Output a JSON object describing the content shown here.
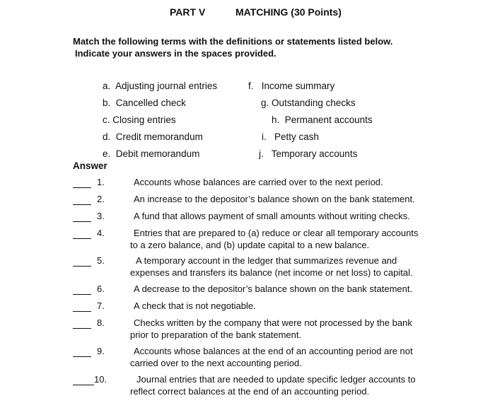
{
  "header": {
    "part": "PART V",
    "title": "MATCHING (30 Points)"
  },
  "instructions": {
    "line1": "Match the following terms with the definitions or statements listed below.",
    "line2": "Indicate your answers in the spaces provided."
  },
  "terms_left": [
    {
      "letter": "a.",
      "term": "Adjusting journal entries"
    },
    {
      "letter": "b.",
      "term": "Cancelled check"
    },
    {
      "letter": "c.",
      "term": "Closing entries"
    },
    {
      "letter": "d.",
      "term": "Credit memorandum"
    },
    {
      "letter": "e.",
      "term": "Debit memorandum"
    }
  ],
  "terms_right": [
    {
      "letter": "f.",
      "term": "Income summary"
    },
    {
      "letter": "g.",
      "term": "Outstanding checks"
    },
    {
      "letter": "h.",
      "term": "Permanent accounts"
    },
    {
      "letter": "i.",
      "term": "Petty cash"
    },
    {
      "letter": "j.",
      "term": "Temporary accounts"
    }
  ],
  "answer_header": "Answer",
  "questions": [
    {
      "number": "1.",
      "line1": "Accounts whose balances are carried over to the next period.",
      "line2": ""
    },
    {
      "number": "2.",
      "line1": "An increase to the depositor’s balance shown on the bank statement.",
      "line2": ""
    },
    {
      "number": "3.",
      "line1": "A fund that allows payment of small amounts without writing checks.",
      "line2": ""
    },
    {
      "number": "4.",
      "line1": "Entries that are prepared to (a) reduce or clear all temporary accounts",
      "line2": "to a zero balance, and (b) update capital to a new balance."
    },
    {
      "number": "5.",
      "line1": "A temporary account in the ledger that summarizes revenue and",
      "line2": "expenses and transfers its balance (net income or net loss) to capital."
    },
    {
      "number": "6.",
      "line1": "A decrease to the depositor’s balance shown on the bank statement.",
      "line2": ""
    },
    {
      "number": "7.",
      "line1": "A check that is not negotiable.",
      "line2": ""
    },
    {
      "number": "8.",
      "line1": "Checks written by the company that were not processed by the bank",
      "line2": "prior to preparation of the bank statement."
    },
    {
      "number": "9.",
      "line1": "Accounts whose balances at the end of an accounting period are not",
      "line2": "carried over to the next accounting period."
    },
    {
      "number": "10.",
      "line1": "Journal entries that are needed to update specific ledger accounts to",
      "line2": "reflect correct balances at the end of an accounting period."
    }
  ]
}
